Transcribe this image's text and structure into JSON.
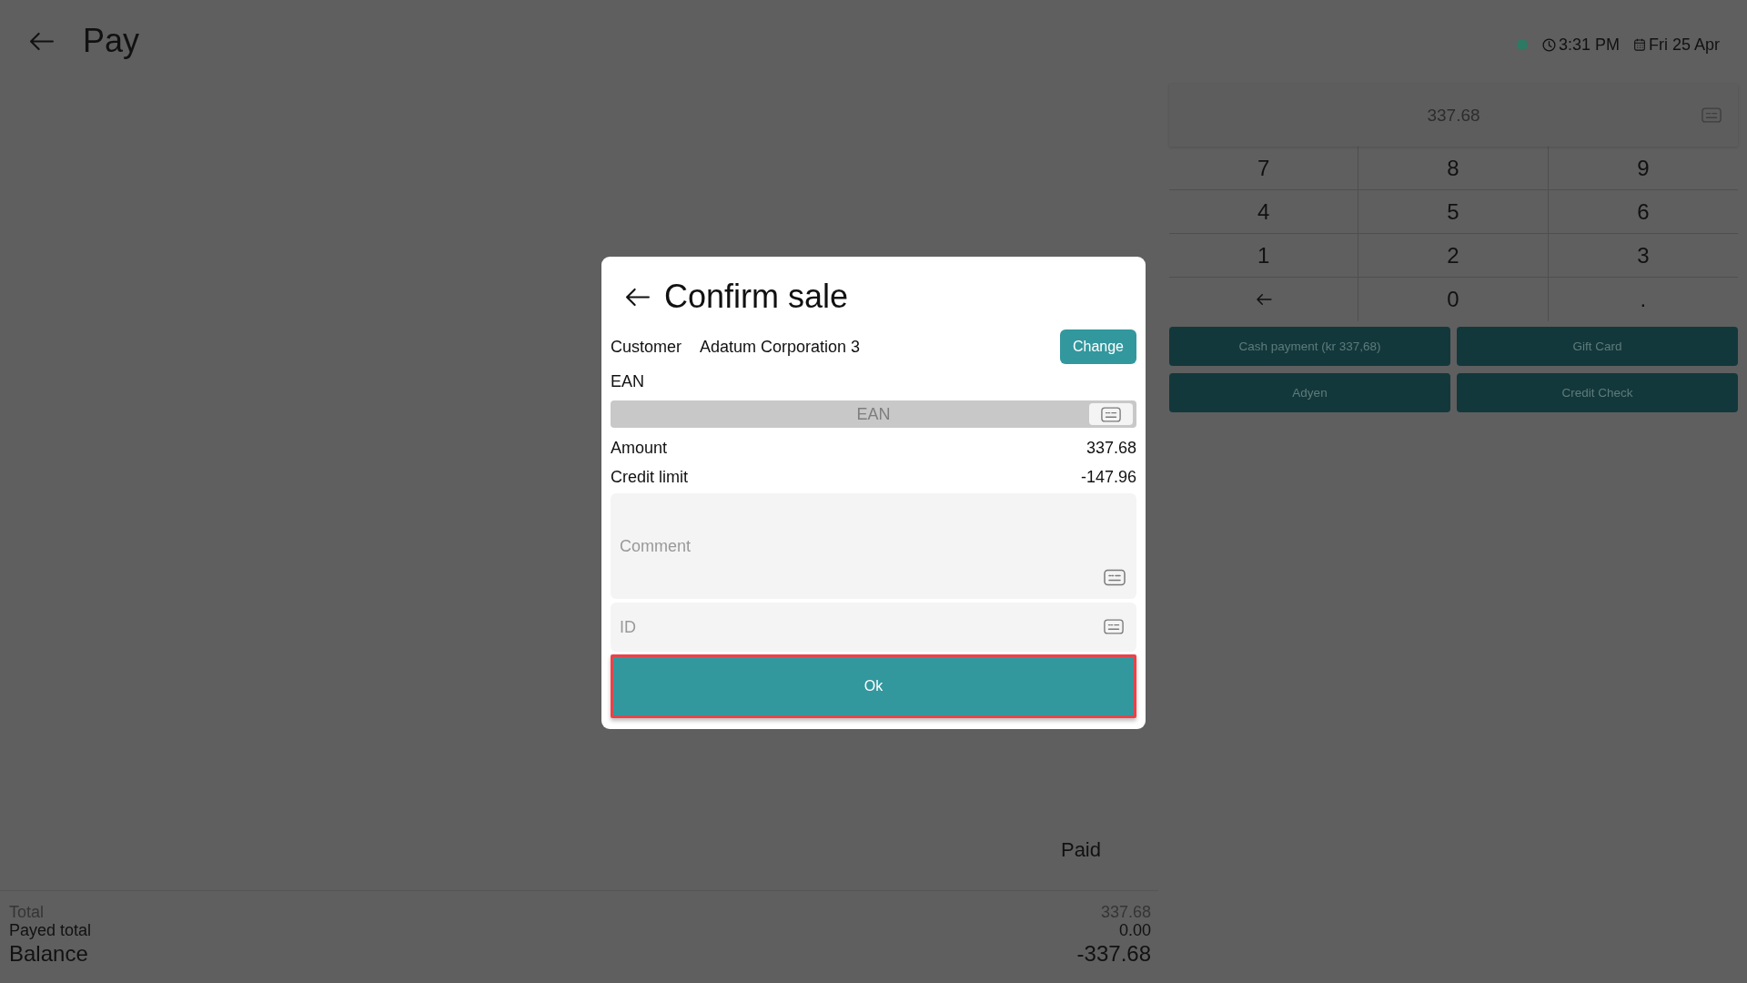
{
  "header": {
    "title": "Pay",
    "connected": true,
    "time": "3:31 PM",
    "date": "Fri 25 Apr"
  },
  "numpad": {
    "display": "337.68",
    "keys": [
      {
        "kind": "digit",
        "label": "7"
      },
      {
        "kind": "digit",
        "label": "8"
      },
      {
        "kind": "digit",
        "label": "9"
      },
      {
        "kind": "digit",
        "label": "4"
      },
      {
        "kind": "digit",
        "label": "5"
      },
      {
        "kind": "digit",
        "label": "6"
      },
      {
        "kind": "digit",
        "label": "1"
      },
      {
        "kind": "digit",
        "label": "2"
      },
      {
        "kind": "digit",
        "label": "3"
      },
      {
        "kind": "backspace"
      },
      {
        "kind": "digit",
        "label": "0"
      },
      {
        "kind": "digit",
        "label": "."
      }
    ]
  },
  "payment_buttons": [
    "Cash payment (kr 337,68)",
    "Gift Card",
    "Adyen",
    "Credit Check"
  ],
  "paid_label": "Paid",
  "totals": [
    {
      "kind": "muted",
      "label": "Total",
      "value": "337.68"
    },
    {
      "kind": "plain",
      "label": "Payed total",
      "value": "0.00"
    },
    {
      "kind": "emphasis",
      "label": "Balance",
      "value": "-337.68"
    }
  ],
  "dialog": {
    "title": "Confirm sale",
    "customer_label": "Customer",
    "customer_name": "Adatum Corporation 3",
    "change_button": "Change",
    "ean_label": "EAN",
    "ean_field": {
      "placeholder": "EAN",
      "disabled": true
    },
    "summary": [
      {
        "label": "Amount",
        "value": "337.68"
      },
      {
        "label": "Credit limit",
        "value": "-147.96"
      }
    ],
    "comment_field": {
      "placeholder": "Comment"
    },
    "id_field": {
      "placeholder": "ID"
    },
    "ok_button": {
      "label": "Ok",
      "focused": true
    }
  }
}
